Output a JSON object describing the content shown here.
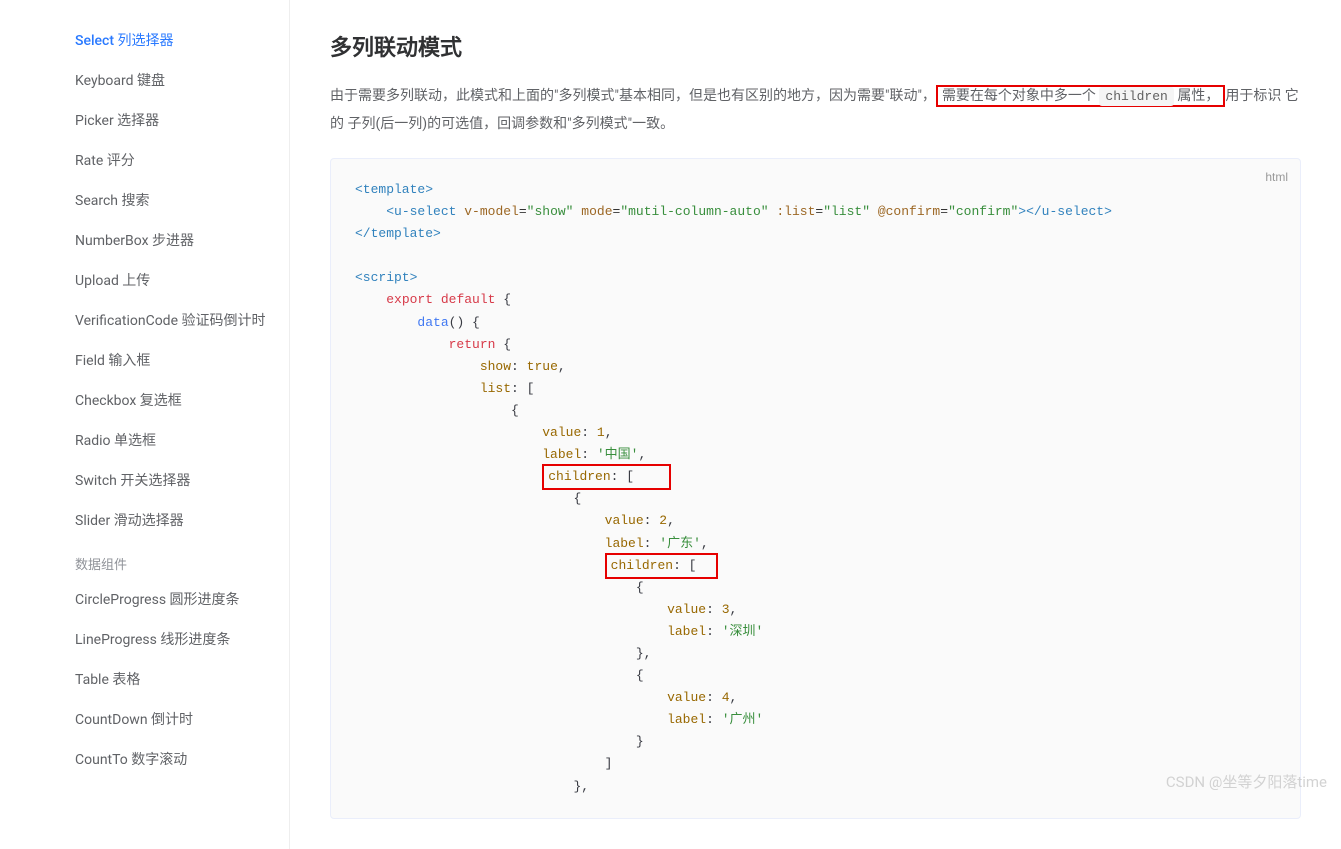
{
  "sidebar": {
    "items": [
      {
        "label": "Select 列选择器",
        "active": true
      },
      {
        "label": "Keyboard 键盘"
      },
      {
        "label": "Picker 选择器"
      },
      {
        "label": "Rate 评分"
      },
      {
        "label": "Search 搜索"
      },
      {
        "label": "NumberBox 步进器"
      },
      {
        "label": "Upload 上传"
      },
      {
        "label": "VerificationCode 验证码倒计时"
      },
      {
        "label": "Field 输入框"
      },
      {
        "label": "Checkbox 复选框"
      },
      {
        "label": "Radio 单选框"
      },
      {
        "label": "Switch 开关选择器"
      },
      {
        "label": "Slider 滑动选择器"
      }
    ],
    "group_label": "数据组件",
    "items2": [
      {
        "label": "CircleProgress 圆形进度条"
      },
      {
        "label": "LineProgress 线形进度条"
      },
      {
        "label": "Table 表格"
      },
      {
        "label": "CountDown 倒计时"
      },
      {
        "label": "CountTo 数字滚动"
      }
    ]
  },
  "main": {
    "heading": "多列联动模式",
    "desc_pre": "由于需要多列联动，此模式和上面的\"多列模式\"基本相同，但是也有区别的地方，因为需要\"联动\"，",
    "desc_hl_pre": "需要在每个对象中多一个 ",
    "code_tag": "children",
    "desc_hl_post": " 属性，",
    "desc_post": "用于标识 它的 子列(后一列)的可选值，回调参数和\"多列模式\"一致。",
    "code_lang": "html"
  },
  "code": {
    "t_open": "<template>",
    "u_open": "<u-select",
    "vmodel": "v-model",
    "show": "\"show\"",
    "mode": "mode",
    "mode_v": "\"mutil-column-auto\"",
    "list_attr": ":list",
    "list_v": "\"list\"",
    "confirm": "@confirm",
    "confirm_v": "\"confirm\"",
    "u_close": "></u-select>",
    "t_close": "</template>",
    "s_open": "<script>",
    "export": "export",
    "default": "default",
    "data": "data",
    "return": "return",
    "show_k": "show",
    "true": "true",
    "list_k": "list",
    "value": "value",
    "label": "label",
    "children": "children",
    "v1": "1",
    "l1": "'中国'",
    "v2": "2",
    "l2": "'广东'",
    "v3": "3",
    "l3": "'深圳'",
    "v4": "4",
    "l4": "'广州'"
  },
  "watermark": "CSDN @坐等夕阳落time"
}
